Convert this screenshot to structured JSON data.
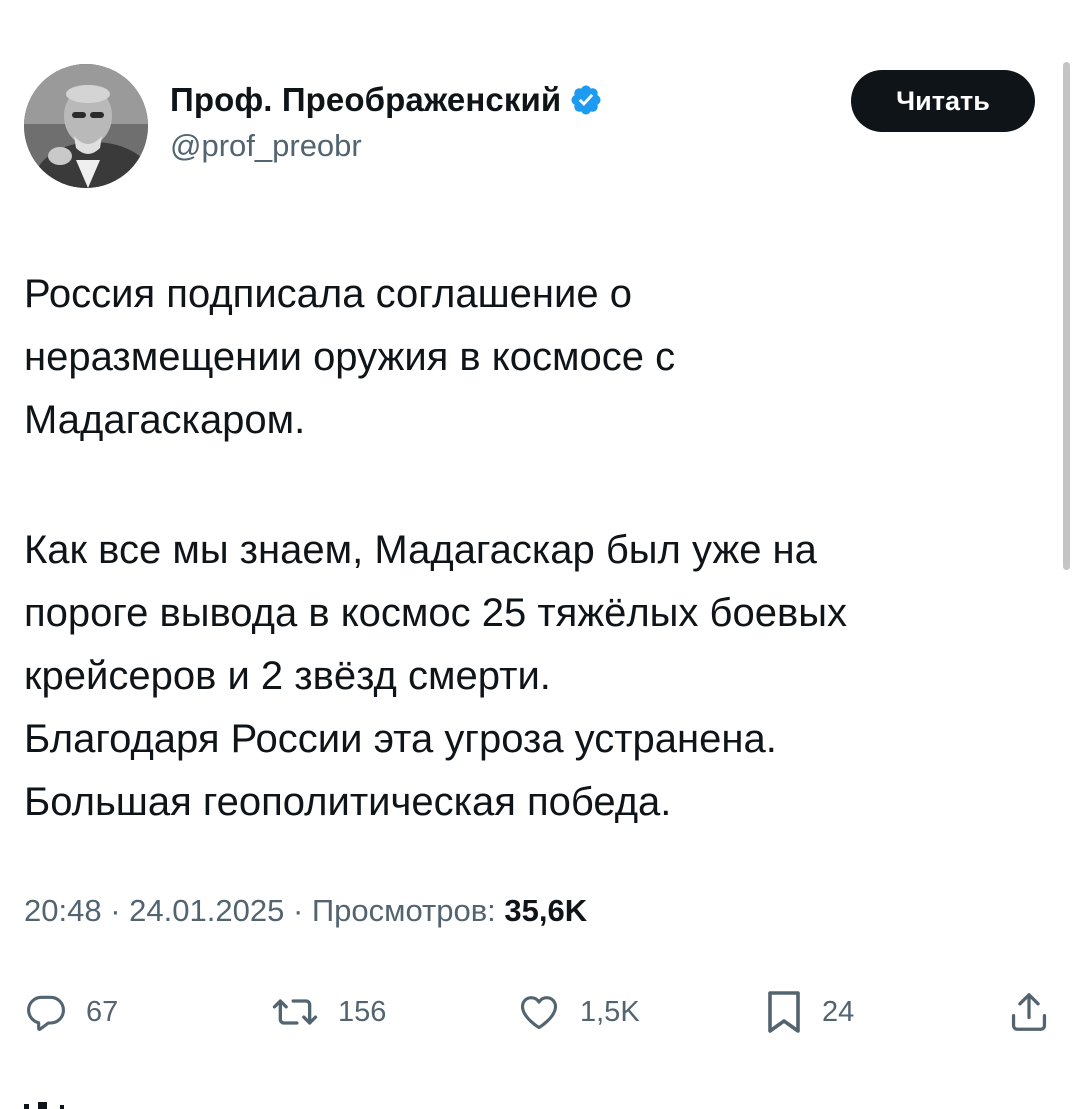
{
  "author": {
    "display_name": "Проф. Преображенский",
    "handle": "@prof_preobr",
    "verified": true
  },
  "follow_button": {
    "label": "Читать"
  },
  "tweet": {
    "paragraph_1": "Россия подписала соглашение о неразмещении оружия в космосе с Мадагаскаром.",
    "paragraph_2_lines": [
      "Как все мы знаем, Мадагаскар был уже на",
      "пороге вывода в космос 25 тяжёлых боевых",
      "крейсеров и 2 звёзд смерти.",
      "Благодаря России эта угроза устранена.",
      "Большая геополитическая победа."
    ],
    "paragraph_1_lines": [
      "Россия подписала соглашение о",
      "неразмещении оружия в космосе с",
      "Мадагаскаром."
    ]
  },
  "meta": {
    "time": "20:48",
    "date": "24.01.2025",
    "views_label": "Просмотров:",
    "views_count": "35,6K",
    "separator": "·"
  },
  "actions": {
    "replies": "67",
    "reposts": "156",
    "likes": "1,5K",
    "bookmarks": "24"
  },
  "colors": {
    "text": "#0f1419",
    "secondary": "#536471",
    "verified_blue": "#1d9bf0",
    "button_bg": "#0f1419"
  }
}
